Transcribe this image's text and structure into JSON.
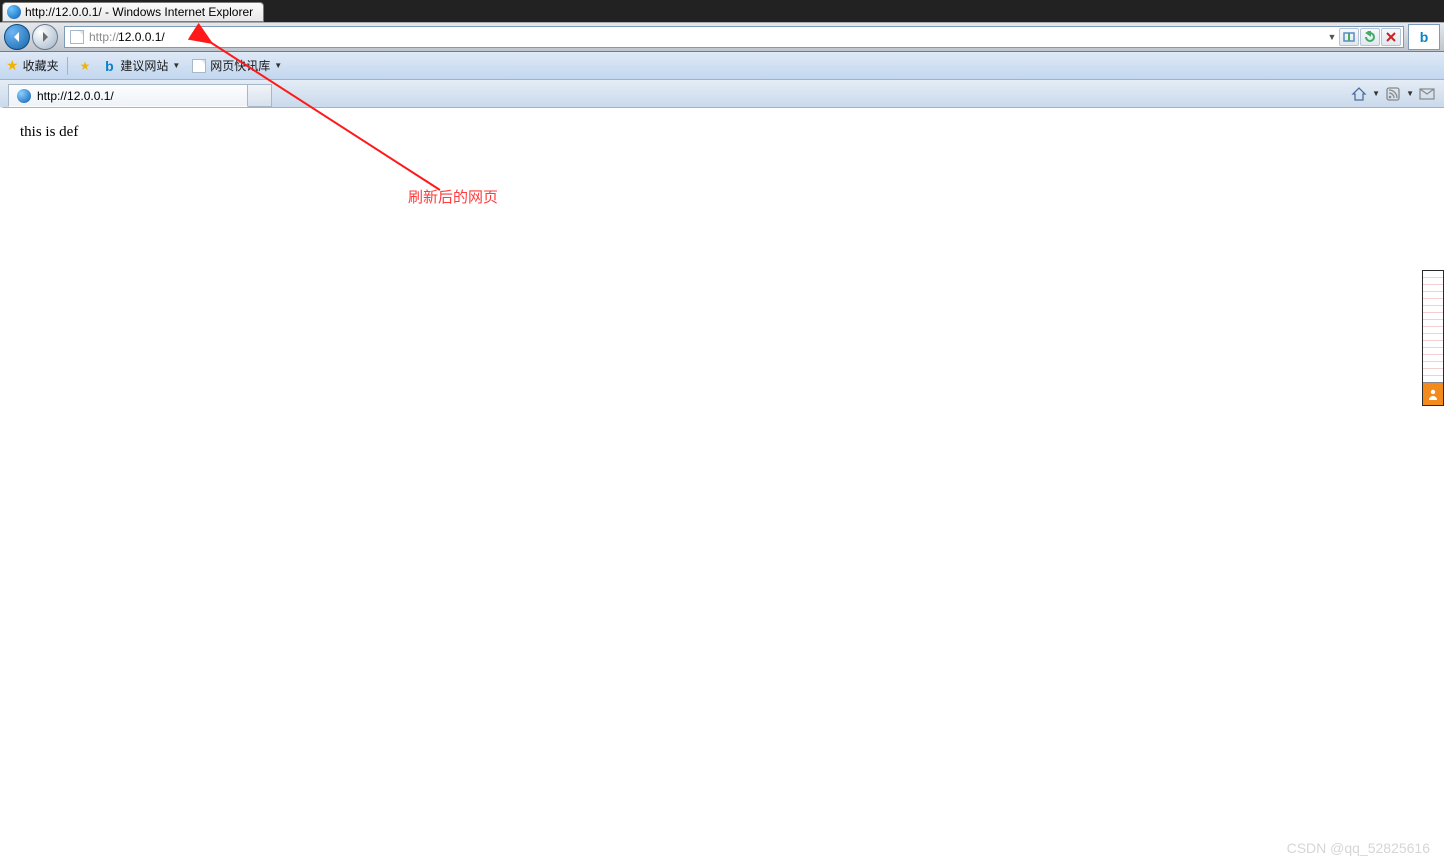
{
  "window": {
    "title": "http://12.0.0.1/ - Windows Internet Explorer"
  },
  "nav": {
    "url_protocol_grey": "http://",
    "url_rest": "12.0.0.1/",
    "full_url": "http://12.0.0.1/"
  },
  "favorites": {
    "label": "收藏夹",
    "suggested_label": "建议网站",
    "gallery_label": "网页快讯库"
  },
  "tab": {
    "title": "http://12.0.0.1/"
  },
  "page": {
    "body_text": "this is def"
  },
  "annotation": {
    "label": "刷新后的网页"
  },
  "watermark": {
    "text": "CSDN @qq_52825616"
  }
}
